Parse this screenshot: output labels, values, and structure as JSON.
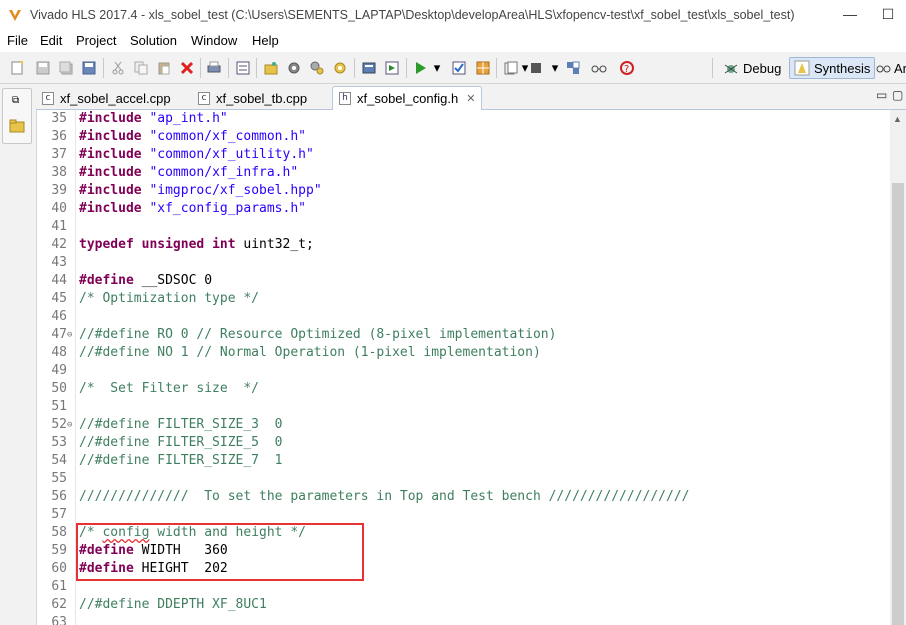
{
  "window": {
    "title": "Vivado HLS 2017.4 - xls_sobel_test (C:\\Users\\SEMENTS_LAPTAP\\Desktop\\developArea\\HLS\\xfopencv-test\\xf_sobel_test\\xls_sobel_test)",
    "minimize": "—",
    "maximize": "☐"
  },
  "menu": {
    "items": [
      "File",
      "Edit",
      "Project",
      "Solution",
      "Window",
      "Help"
    ]
  },
  "toolbar": {
    "perspectives": {
      "debug": "Debug",
      "synthesis": "Synthesis",
      "analysis": "Ar"
    }
  },
  "tabs": [
    {
      "label": "xf_sobel_accel.cpp",
      "icon": "c-file-icon"
    },
    {
      "label": "xf_sobel_tb.cpp",
      "icon": "c-file-icon"
    },
    {
      "label": "xf_sobel_config.h",
      "icon": "h-file-icon",
      "close": "✕"
    }
  ],
  "tab_controls": {
    "minimize": "▭",
    "maximize": "▢"
  },
  "code": [
    {
      "n": "35",
      "parts": [
        [
          "kw",
          "#include"
        ],
        [
          "plain",
          " "
        ],
        [
          "str",
          "\"ap_int.h\""
        ]
      ]
    },
    {
      "n": "36",
      "parts": [
        [
          "kw",
          "#include"
        ],
        [
          "plain",
          " "
        ],
        [
          "str",
          "\"common/xf_common.h\""
        ]
      ]
    },
    {
      "n": "37",
      "parts": [
        [
          "kw",
          "#include"
        ],
        [
          "plain",
          " "
        ],
        [
          "str",
          "\"common/xf_utility.h\""
        ]
      ]
    },
    {
      "n": "38",
      "parts": [
        [
          "kw",
          "#include"
        ],
        [
          "plain",
          " "
        ],
        [
          "str",
          "\"common/xf_infra.h\""
        ]
      ]
    },
    {
      "n": "39",
      "parts": [
        [
          "kw",
          "#include"
        ],
        [
          "plain",
          " "
        ],
        [
          "str",
          "\"imgproc/xf_sobel.hpp\""
        ]
      ]
    },
    {
      "n": "40",
      "parts": [
        [
          "kw",
          "#include"
        ],
        [
          "plain",
          " "
        ],
        [
          "str",
          "\"xf_config_params.h\""
        ]
      ]
    },
    {
      "n": "41",
      "parts": []
    },
    {
      "n": "42",
      "parts": [
        [
          "kw",
          "typedef"
        ],
        [
          "plain",
          " "
        ],
        [
          "kw",
          "unsigned"
        ],
        [
          "plain",
          " "
        ],
        [
          "kw",
          "int"
        ],
        [
          "plain",
          " uint32_t;"
        ]
      ]
    },
    {
      "n": "43",
      "parts": []
    },
    {
      "n": "44",
      "parts": [
        [
          "kw",
          "#define"
        ],
        [
          "plain",
          " __SDSOC 0"
        ]
      ]
    },
    {
      "n": "45",
      "parts": [
        [
          "cm",
          "/* Optimization type */"
        ]
      ]
    },
    {
      "n": "46",
      "parts": []
    },
    {
      "n": "47",
      "fold": "⊖",
      "parts": [
        [
          "cm",
          "//#define RO 0 // Resource Optimized (8-pixel implementation)"
        ]
      ]
    },
    {
      "n": "48",
      "parts": [
        [
          "cm",
          "//#define NO 1 // Normal Operation (1-pixel implementation)"
        ]
      ]
    },
    {
      "n": "49",
      "parts": []
    },
    {
      "n": "50",
      "parts": [
        [
          "cm",
          "/*  Set Filter size  */"
        ]
      ]
    },
    {
      "n": "51",
      "parts": []
    },
    {
      "n": "52",
      "fold": "⊖",
      "parts": [
        [
          "cm",
          "//#define FILTER_SIZE_3  0"
        ]
      ]
    },
    {
      "n": "53",
      "parts": [
        [
          "cm",
          "//#define FILTER_SIZE_5  0"
        ]
      ]
    },
    {
      "n": "54",
      "parts": [
        [
          "cm",
          "//#define FILTER_SIZE_7  1"
        ]
      ]
    },
    {
      "n": "55",
      "parts": []
    },
    {
      "n": "56",
      "parts": [
        [
          "cm",
          "//////////////  To set the parameters in Top and Test bench //////////////////"
        ]
      ]
    },
    {
      "n": "57",
      "parts": []
    },
    {
      "n": "58",
      "parts": [
        [
          "cm",
          "/* "
        ],
        [
          "cm squiggle",
          "config"
        ],
        [
          "cm",
          " width and height */"
        ]
      ]
    },
    {
      "n": "59",
      "parts": [
        [
          "kw",
          "#define"
        ],
        [
          "plain",
          " WIDTH   360"
        ]
      ]
    },
    {
      "n": "60",
      "parts": [
        [
          "kw",
          "#define"
        ],
        [
          "plain",
          " HEIGHT  202"
        ]
      ]
    },
    {
      "n": "61",
      "parts": []
    },
    {
      "n": "62",
      "parts": [
        [
          "cm",
          "//#define DDEPTH XF_8UC1"
        ]
      ]
    },
    {
      "n": "63",
      "parts": []
    }
  ],
  "colors": {
    "keyword": "#7f0055",
    "string": "#2a00ff",
    "comment": "#3f7f5f",
    "highlight_box": "#e53333"
  }
}
